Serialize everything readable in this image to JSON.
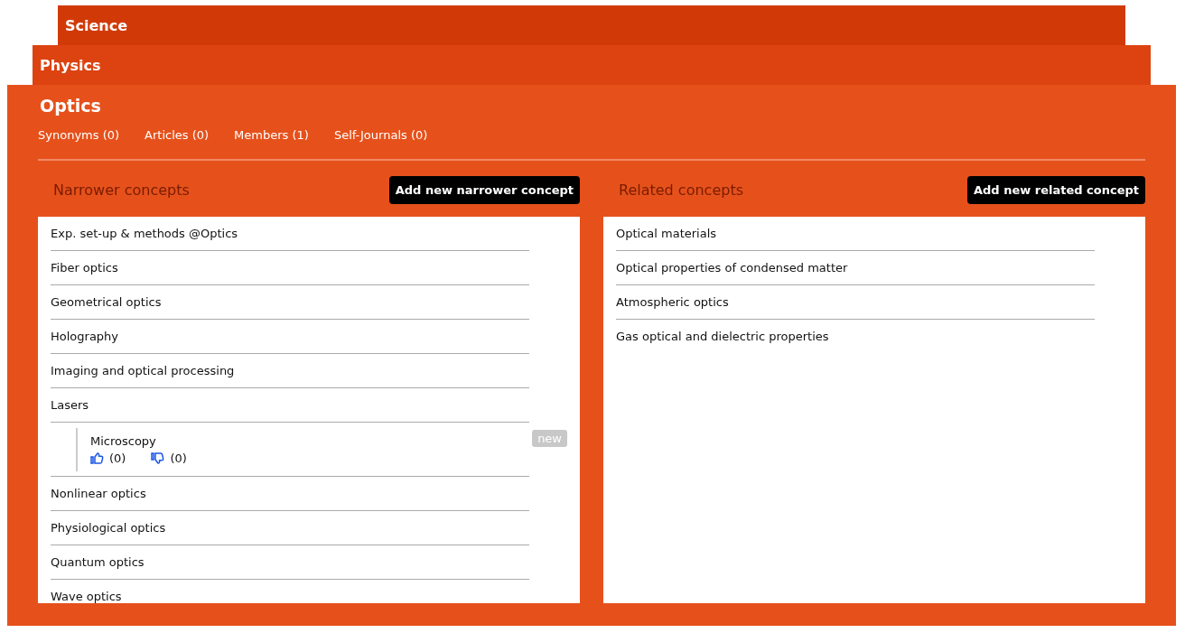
{
  "breadcrumbs": [
    {
      "label": "Science"
    },
    {
      "label": "Physics"
    }
  ],
  "concept": {
    "title": "Optics",
    "stats": [
      {
        "label": "Synonyms (0)"
      },
      {
        "label": "Articles (0)"
      },
      {
        "label": "Members (1)"
      },
      {
        "label": "Self-Journals (0)"
      }
    ]
  },
  "narrower": {
    "heading": "Narrower concepts",
    "button": "Add new narrower concept",
    "items": [
      {
        "kind": "concept",
        "label": "Exp. set-up & methods @Optics"
      },
      {
        "kind": "concept",
        "label": "Fiber optics"
      },
      {
        "kind": "concept",
        "label": "Geometrical optics"
      },
      {
        "kind": "concept",
        "label": "Holography"
      },
      {
        "kind": "concept",
        "label": "Imaging and optical processing"
      },
      {
        "kind": "concept",
        "label": "Lasers"
      },
      {
        "kind": "proposal",
        "label": "Microscopy",
        "likes": "(0)",
        "dislikes": "(0)",
        "badge": "new"
      },
      {
        "kind": "concept",
        "label": "Nonlinear optics"
      },
      {
        "kind": "concept",
        "label": "Physiological optics"
      },
      {
        "kind": "concept",
        "label": "Quantum optics"
      },
      {
        "kind": "concept",
        "label": "Wave optics"
      }
    ]
  },
  "related": {
    "heading": "Related concepts",
    "button": "Add new related concept",
    "items": [
      {
        "kind": "concept",
        "label": "Optical materials"
      },
      {
        "kind": "concept",
        "label": "Optical properties of condensed matter"
      },
      {
        "kind": "concept",
        "label": "Atmospheric optics"
      },
      {
        "kind": "concept",
        "label": "Gas optical and dielectric properties"
      }
    ]
  }
}
